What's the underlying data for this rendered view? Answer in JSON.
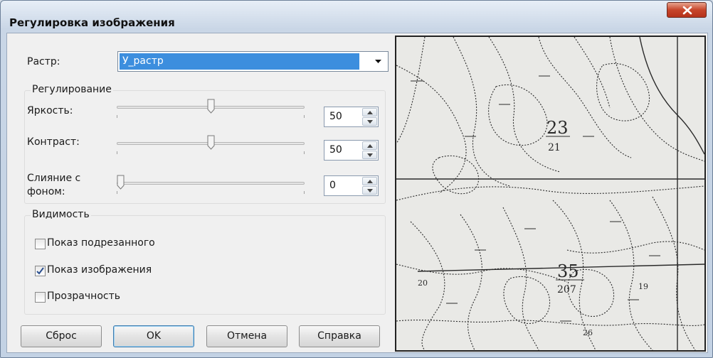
{
  "window": {
    "title": "Регулировка изображения"
  },
  "raster": {
    "label": "Растр:",
    "selected": "У_растр"
  },
  "adjust": {
    "group_title": "Регулирование",
    "brightness": {
      "label": "Яркость:",
      "value": "50",
      "level": 0.5
    },
    "contrast": {
      "label": "Контраст:",
      "value": "50",
      "level": 0.5
    },
    "blend": {
      "label_line1": "Слияние с",
      "label_line2": "фоном:",
      "value": "0",
      "level": 0.0
    }
  },
  "visibility": {
    "group_title": "Видимость",
    "items": [
      {
        "label": "Показ подрезанного",
        "checked": false
      },
      {
        "label": "Показ изображения",
        "checked": true
      },
      {
        "label": "Прозрачность",
        "checked": false
      }
    ]
  },
  "buttons": {
    "reset": "Сброс",
    "ok": "OK",
    "cancel": "Отмена",
    "help": "Справка"
  },
  "preview": {
    "labels": [
      "23",
      "21",
      "35",
      "207",
      "19",
      "20",
      "26"
    ]
  },
  "colors": {
    "selection": "#3c8ede",
    "close": "#c7452a",
    "map_ink": "#2a2a2a",
    "map_paper": "#e9e9e6"
  }
}
